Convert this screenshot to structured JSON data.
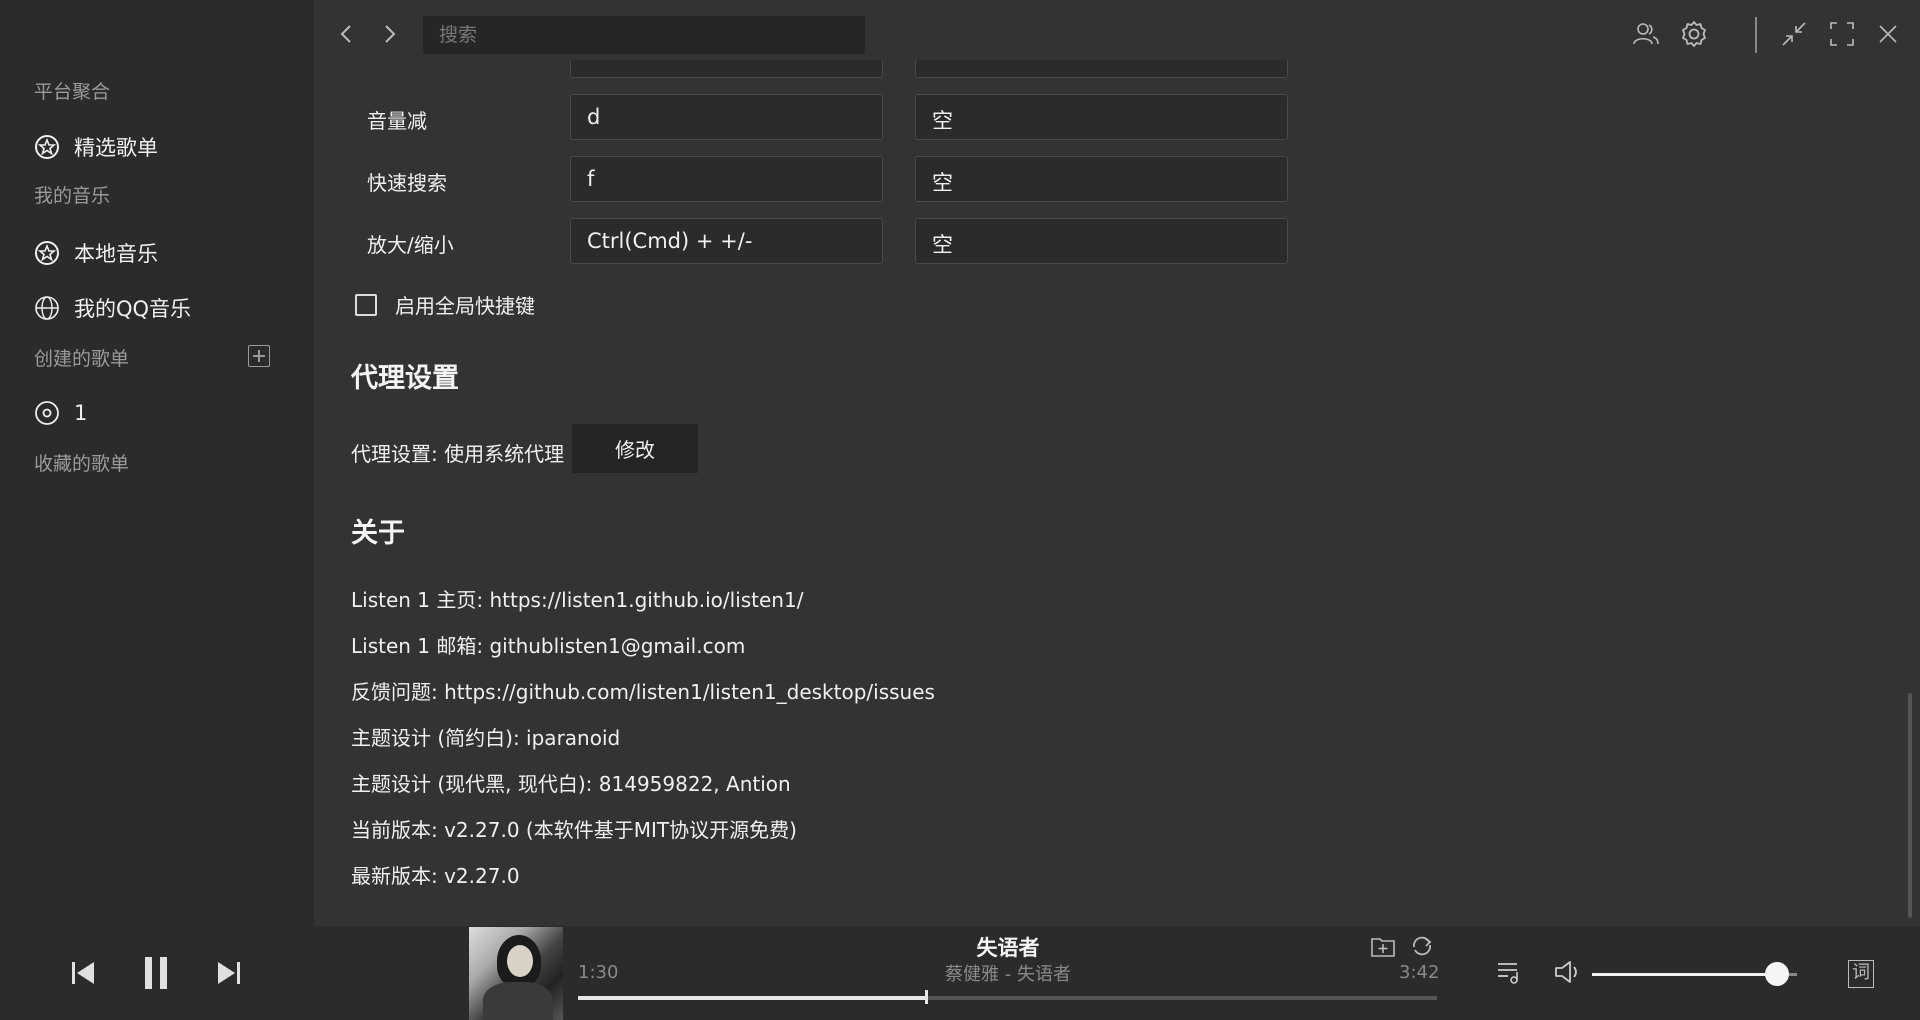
{
  "sidebar": {
    "sections": [
      "平台聚合",
      "我的音乐",
      "创建的歌单",
      "收藏的歌单"
    ],
    "items": [
      {
        "label": "精选歌单",
        "icon": "star-icon"
      },
      {
        "label": "本地音乐",
        "icon": "star-icon"
      },
      {
        "label": "我的QQ音乐",
        "icon": "globe-icon"
      },
      {
        "label": "1",
        "icon": "disc-icon"
      }
    ]
  },
  "topbar": {
    "search_placeholder": "搜索"
  },
  "shortcuts": [
    {
      "label": "音量减",
      "key": "d",
      "global": "空"
    },
    {
      "label": "快速搜索",
      "key": "f",
      "global": "空"
    },
    {
      "label": "放大/缩小",
      "key": "Ctrl(Cmd) + +/-",
      "global": "空"
    }
  ],
  "global_shortcut_label": "启用全局快捷键",
  "proxy": {
    "title": "代理设置",
    "text": "代理设置: 使用系统代理",
    "button": "修改"
  },
  "about": {
    "title": "关于",
    "lines": [
      "Listen 1 主页: https://listen1.github.io/listen1/",
      "Listen 1 邮箱: githublisten1@gmail.com",
      "反馈问题: https://github.com/listen1/listen1_desktop/issues",
      "主题设计 (简约白): iparanoid",
      "主题设计 (现代黑, 现代白): 814959822, Antion",
      "当前版本: v2.27.0 (本软件基于MIT协议开源免费)",
      "最新版本: v2.27.0"
    ]
  },
  "player": {
    "title": "失语者",
    "artist": "蔡健雅 - 失语者",
    "current_time": "1:30",
    "total_time": "3:42",
    "progress": 0.405,
    "volume": 0.9,
    "lyrics_label": "词"
  }
}
